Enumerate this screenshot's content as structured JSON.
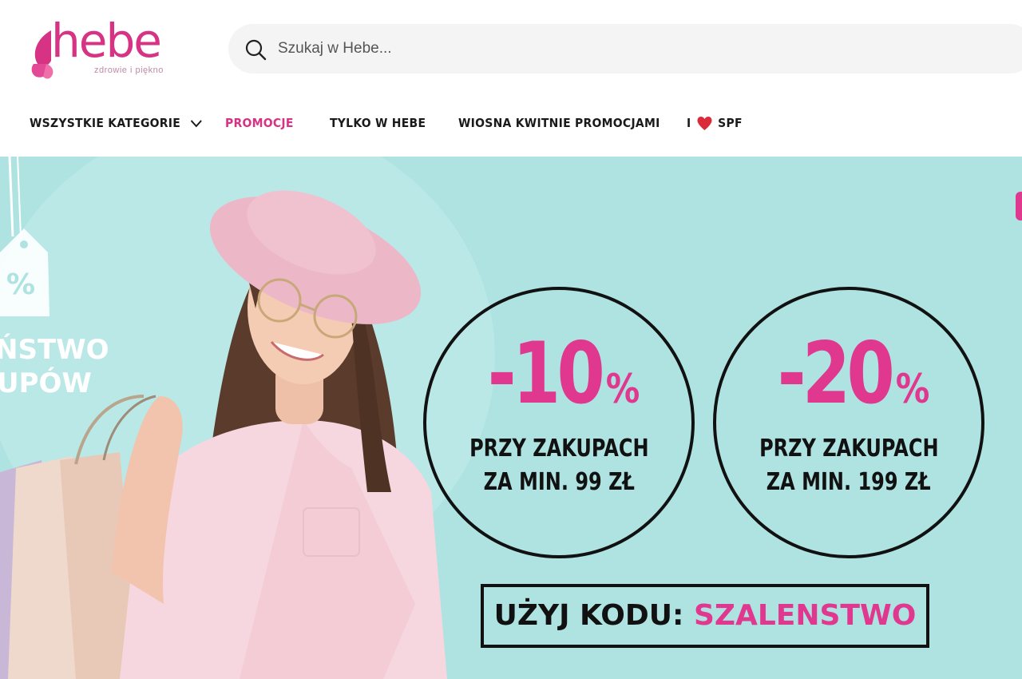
{
  "brand": {
    "name": "hebe",
    "tagline": "zdrowie i piękno",
    "color": "#d63384"
  },
  "search": {
    "placeholder": "Szukaj w Hebe..."
  },
  "nav": {
    "items": [
      {
        "label": "WSZYSTKIE KATEGORIE",
        "icon": "chevron-down-icon"
      },
      {
        "label": "PROMOCJE",
        "color": "#d63384"
      },
      {
        "label": "TYLKO W HEBE"
      },
      {
        "label": "WIOSNA KWITNIE PROMOCJAMI"
      },
      {
        "label_prefix": "I",
        "label_suffix": "SPF",
        "icon": "heart-icon"
      }
    ]
  },
  "banner": {
    "background_color": "#aee3e2",
    "side_text": [
      "ŃSTWO",
      "UPÓW"
    ],
    "tag_text": "%",
    "offers": [
      {
        "discount": "-10",
        "symbol": "%",
        "line1": "PRZY ZAKUPACH",
        "line2": "ZA MIN. 99 ZŁ"
      },
      {
        "discount": "-20",
        "symbol": "%",
        "line1": "PRZY ZAKUPACH",
        "line2": "ZA MIN. 199 ZŁ"
      }
    ],
    "code_label": "UŻYJ KODU:",
    "code_value": "SZALENSTWO",
    "accent_color": "#e0378f"
  }
}
